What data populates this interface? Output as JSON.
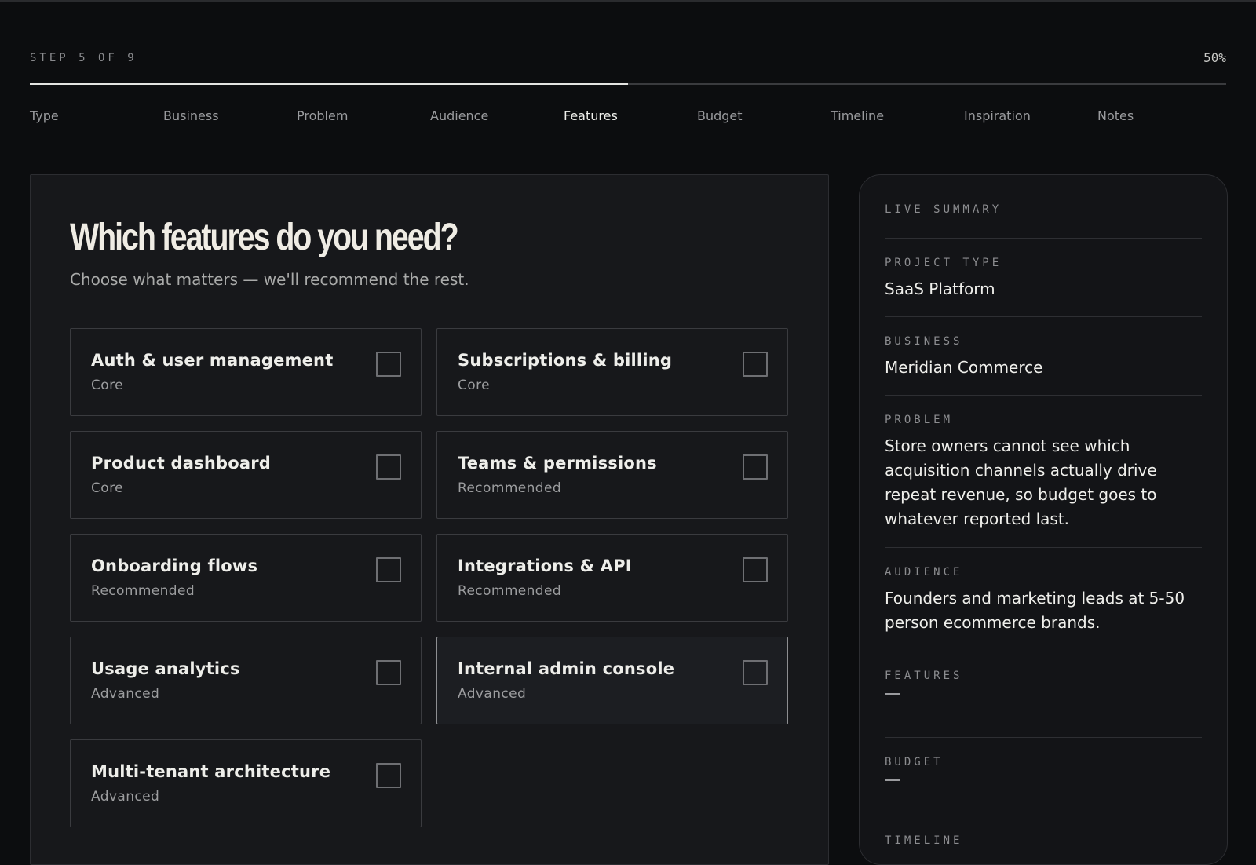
{
  "progress": {
    "step_label": "STEP 5 OF 9",
    "percent_label": "50%",
    "fraction": 0.5
  },
  "steps": [
    "Type",
    "Business",
    "Problem",
    "Audience",
    "Features",
    "Budget",
    "Timeline",
    "Inspiration",
    "Notes"
  ],
  "active_step": "Features",
  "card": {
    "title": "Which features do you need?",
    "subtitle": "Choose what matters — we'll recommend the rest.",
    "options": [
      {
        "label": "Auth & user management",
        "tier": "Core",
        "checked": false
      },
      {
        "label": "Subscriptions & billing",
        "tier": "Core",
        "checked": false
      },
      {
        "label": "Product dashboard",
        "tier": "Core",
        "checked": false
      },
      {
        "label": "Teams & permissions",
        "tier": "Recommended",
        "checked": false
      },
      {
        "label": "Onboarding flows",
        "tier": "Recommended",
        "checked": false
      },
      {
        "label": "Integrations & API",
        "tier": "Recommended",
        "checked": false
      },
      {
        "label": "Usage analytics",
        "tier": "Advanced",
        "checked": false
      },
      {
        "label": "Internal admin console",
        "tier": "Advanced",
        "checked": false
      },
      {
        "label": "Multi-tenant architecture",
        "tier": "Advanced",
        "checked": false
      }
    ]
  },
  "summary": {
    "heading": "LIVE SUMMARY",
    "project_type": {
      "key": "PROJECT TYPE",
      "value": "SaaS Platform"
    },
    "business": {
      "key": "BUSINESS",
      "value": "Meridian Commerce"
    },
    "problem": {
      "key": "PROBLEM",
      "value": "Store owners cannot see which acquisition channels actually drive repeat revenue, so budget goes to whatever reported last."
    },
    "audience": {
      "key": "AUDIENCE",
      "value": "Founders and marketing leads at 5-50 person ecommerce brands."
    },
    "features": {
      "key": "FEATURES",
      "value": ""
    },
    "budget": {
      "key": "BUDGET",
      "value": ""
    },
    "timeline": {
      "key": "TIMELINE",
      "value": ""
    }
  },
  "colors": {
    "background": "#0c0d0f",
    "card": "#17181b",
    "accent": "#e4e4e1"
  }
}
